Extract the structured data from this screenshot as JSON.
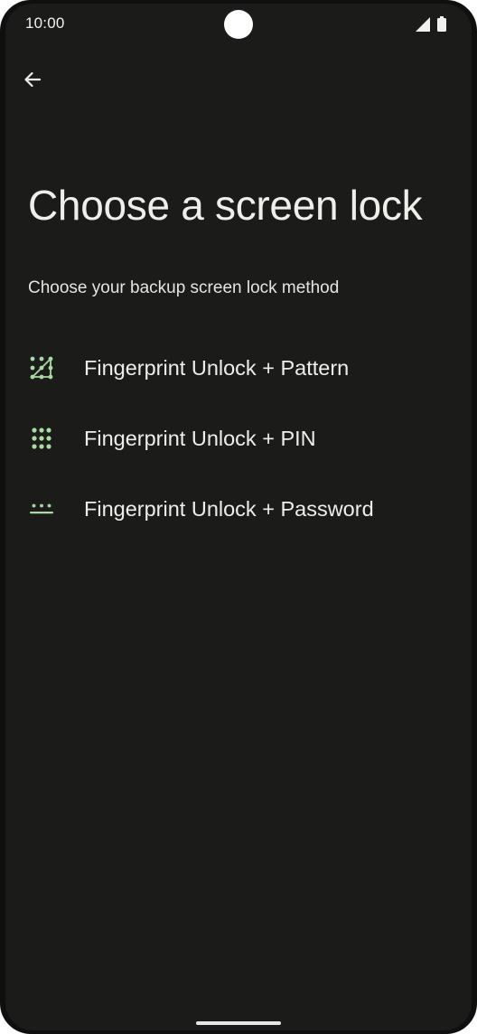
{
  "status_bar": {
    "time": "10:00",
    "icons": [
      "camera-cutout",
      "signal-icon",
      "battery-icon"
    ]
  },
  "header": {
    "back_icon": "arrow-left-icon",
    "title": "Choose a screen lock",
    "subtitle": "Choose your backup screen lock method"
  },
  "options": [
    {
      "icon": "pattern-icon",
      "label": "Fingerprint Unlock + Pattern"
    },
    {
      "icon": "pin-icon",
      "label": "Fingerprint Unlock + PIN"
    },
    {
      "icon": "password-icon",
      "label": "Fingerprint Unlock + Password"
    }
  ],
  "colors": {
    "background": "#1b1c1a",
    "text_primary": "#eeeeea",
    "icon_accent": "#a8d9a2"
  }
}
